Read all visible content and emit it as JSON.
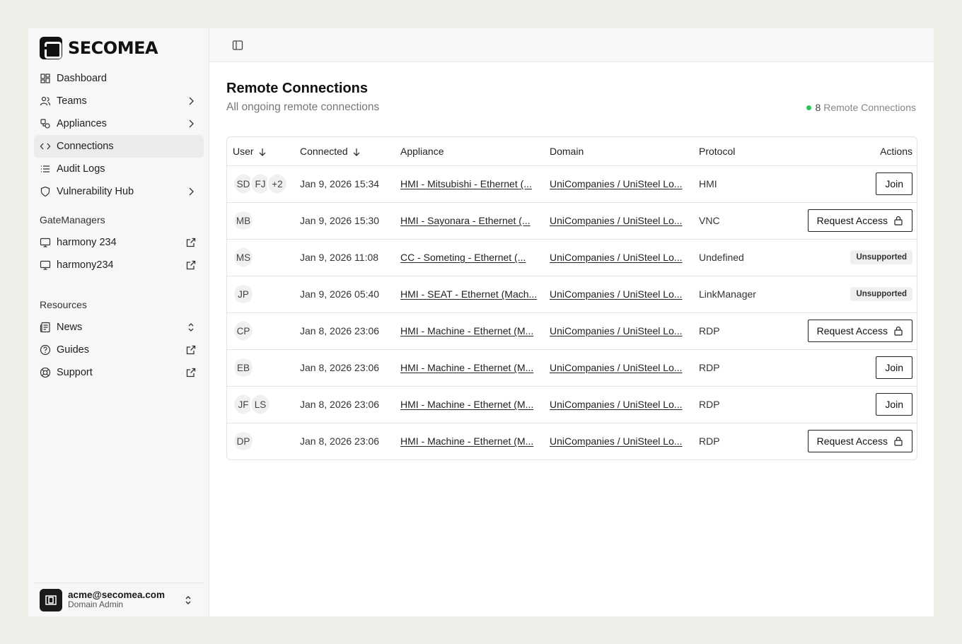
{
  "brand": {
    "name": "SECOMEA"
  },
  "sidebar": {
    "items": [
      {
        "label": "Dashboard",
        "icon": "dashboard-icon",
        "trail": ""
      },
      {
        "label": "Teams",
        "icon": "users-icon",
        "trail": "chevron-right"
      },
      {
        "label": "Appliances",
        "icon": "appliances-icon",
        "trail": "chevron-right"
      },
      {
        "label": "Connections",
        "icon": "code-brackets-icon",
        "trail": "",
        "active": true
      },
      {
        "label": "Audit Logs",
        "icon": "list-icon",
        "trail": ""
      },
      {
        "label": "Vulnerability Hub",
        "icon": "shield-icon",
        "trail": "chevron-right"
      }
    ],
    "gatemanagers_label": "GateManagers",
    "gatemanagers": [
      {
        "label": "harmony 234"
      },
      {
        "label": "harmony234"
      }
    ],
    "resources_label": "Resources",
    "resources": [
      {
        "label": "News",
        "icon": "news-icon",
        "trail": "chevron-updown"
      },
      {
        "label": "Guides",
        "icon": "help-circle-icon",
        "trail": "external-link"
      },
      {
        "label": "Support",
        "icon": "lifebuoy-icon",
        "trail": "external-link"
      }
    ]
  },
  "user": {
    "email": "acme@secomea.com",
    "role": "Domain Admin"
  },
  "page": {
    "title": "Remote Connections",
    "subtitle": "All ongoing remote connections",
    "count_number": "8",
    "count_label": "Remote Connections",
    "status_color": "#2bc35a"
  },
  "table": {
    "headers": {
      "user": "User",
      "connected": "Connected",
      "appliance": "Appliance",
      "domain": "Domain",
      "protocol": "Protocol",
      "actions": "Actions"
    },
    "rows": [
      {
        "users": [
          "SD",
          "FJ",
          "+2"
        ],
        "connected": "Jan 9, 2026 15:34",
        "appliance": "HMI - Mitsubishi - Ethernet (...",
        "domain": "UniCompanies / UniSteel Lo...",
        "protocol": "HMI",
        "action": "Join",
        "action_type": "join"
      },
      {
        "users": [
          "MB"
        ],
        "connected": "Jan 9, 2026 15:30",
        "appliance": "HMI - Sayonara - Ethernet (...",
        "domain": "UniCompanies / UniSteel Lo...",
        "protocol": "VNC",
        "action": "Request Access",
        "action_type": "request"
      },
      {
        "users": [
          "MS"
        ],
        "connected": "Jan 9, 2026 11:08",
        "appliance": "CC -  Someting - Ethernet (...",
        "domain": "UniCompanies / UniSteel Lo...",
        "protocol": "Undefined",
        "action": "Unsupported",
        "action_type": "badge"
      },
      {
        "users": [
          "JP"
        ],
        "connected": "Jan 9, 2026 05:40",
        "appliance": "HMI - SEAT - Ethernet (Mach...",
        "domain": "UniCompanies / UniSteel Lo...",
        "protocol": "LinkManager",
        "action": "Unsupported",
        "action_type": "badge"
      },
      {
        "users": [
          "CP"
        ],
        "connected": "Jan 8, 2026 23:06",
        "appliance": "HMI - Machine - Ethernet (M...",
        "domain": "UniCompanies / UniSteel Lo...",
        "protocol": "RDP",
        "action": "Request Access",
        "action_type": "request"
      },
      {
        "users": [
          "EB"
        ],
        "connected": "Jan 8, 2026 23:06",
        "appliance": "HMI - Machine - Ethernet (M...",
        "domain": "UniCompanies / UniSteel Lo...",
        "protocol": "RDP",
        "action": "Join",
        "action_type": "join"
      },
      {
        "users": [
          "JF",
          "LS"
        ],
        "connected": "Jan 8, 2026 23:06",
        "appliance": "HMI - Machine - Ethernet (M...",
        "domain": "UniCompanies / UniSteel Lo...",
        "protocol": "RDP",
        "action": "Join",
        "action_type": "join"
      },
      {
        "users": [
          "DP"
        ],
        "connected": "Jan 8, 2026 23:06",
        "appliance": "HMI - Machine - Ethernet (M...",
        "domain": "UniCompanies / UniSteel Lo...",
        "protocol": "RDP",
        "action": "Request Access",
        "action_type": "request"
      }
    ]
  }
}
